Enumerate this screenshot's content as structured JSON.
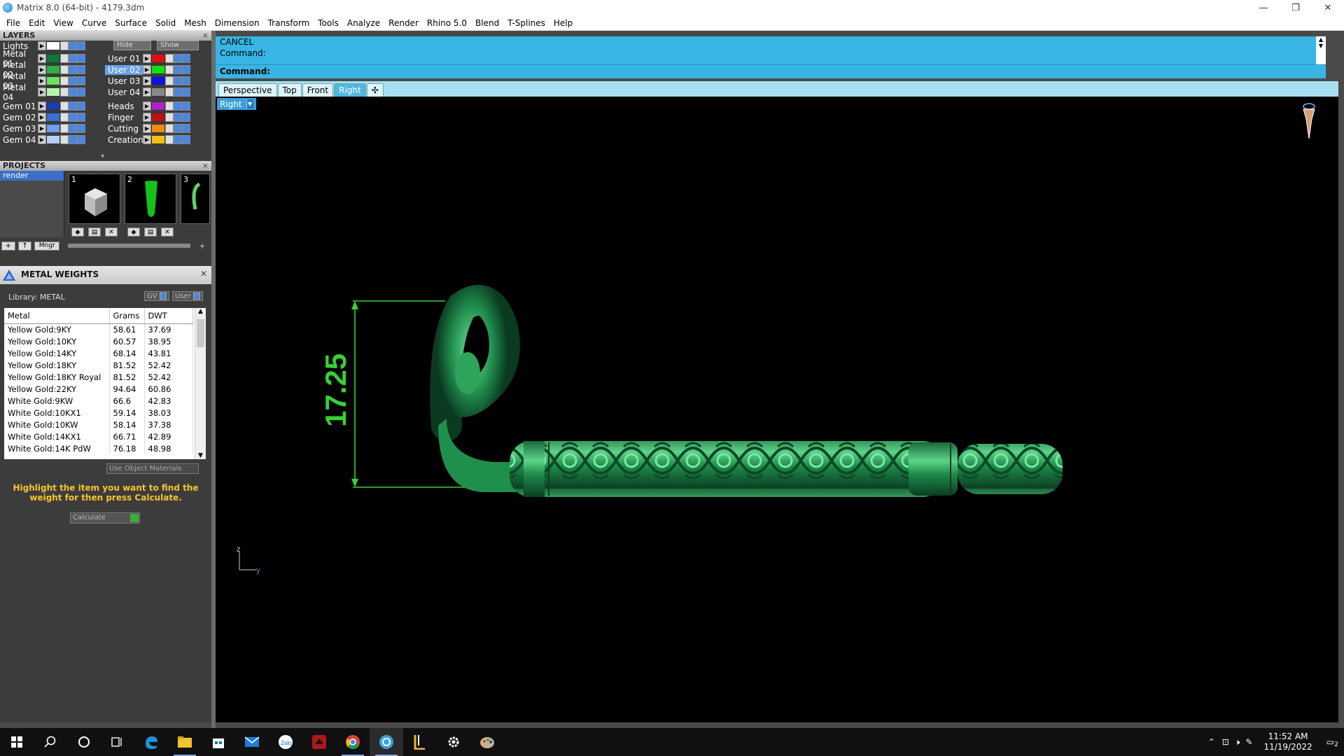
{
  "window": {
    "title": "Matrix 8.0 (64-bit) - 4179.3dm",
    "minimize": "—",
    "restore": "❐",
    "close": "✕"
  },
  "menu": [
    "File",
    "Edit",
    "View",
    "Curve",
    "Surface",
    "Solid",
    "Mesh",
    "Dimension",
    "Transform",
    "Tools",
    "Analyze",
    "Render",
    "Rhino 5.0",
    "Blend",
    "T-Splines",
    "Help"
  ],
  "layers": {
    "header": "LAYERS",
    "hide_label": "Hide",
    "show_label": "Show",
    "left": [
      {
        "name": "Lights",
        "color": "#ffffff"
      },
      {
        "name": "Metal 01",
        "color": "#0e7a3a"
      },
      {
        "name": "Metal 02",
        "color": "#2fb04a"
      },
      {
        "name": "Metal 03",
        "color": "#6de35a"
      },
      {
        "name": "Metal 04",
        "color": "#b9f5a8"
      },
      {
        "name": "Gem 01",
        "color": "#1840a8"
      },
      {
        "name": "Gem 02",
        "color": "#3a6fd6"
      },
      {
        "name": "Gem 03",
        "color": "#6a9ef0"
      },
      {
        "name": "Gem 04",
        "color": "#b3cff8"
      }
    ],
    "right": [
      {
        "name": "User 01",
        "color": "#e01010"
      },
      {
        "name": "User 02",
        "color": "#10e010"
      },
      {
        "name": "User 03",
        "color": "#1010e0"
      },
      {
        "name": "User 04",
        "color": "#888888"
      },
      {
        "name": "Heads",
        "color": "#b020c8"
      },
      {
        "name": "Finger",
        "color": "#c01010"
      },
      {
        "name": "Cutting",
        "color": "#f08a10"
      },
      {
        "name": "Creation",
        "color": "#f2c010"
      }
    ]
  },
  "projects": {
    "header": "PROJECTS",
    "selected": "render",
    "thumbs": [
      "1",
      "2",
      "3"
    ],
    "mngr_label": "Mngr"
  },
  "metal_weights": {
    "header": "METAL WEIGHTS",
    "library": "Library: METAL",
    "toggle_gv": "GV",
    "toggle_user": "User",
    "columns": [
      "Metal",
      "Grams",
      "DWT"
    ],
    "rows": [
      [
        "Yellow Gold:9KY",
        "58.61",
        "37.69"
      ],
      [
        "Yellow Gold:10KY",
        "60.57",
        "38.95"
      ],
      [
        "Yellow Gold:14KY",
        "68.14",
        "43.81"
      ],
      [
        "Yellow Gold:18KY",
        "81.52",
        "52.42"
      ],
      [
        "Yellow Gold:18KY Royal",
        "81.52",
        "52.42"
      ],
      [
        "Yellow Gold:22KY",
        "94.64",
        "60.86"
      ],
      [
        "White Gold:9KW",
        "66.6",
        "42.83"
      ],
      [
        "White Gold:10KX1",
        "59.14",
        "38.03"
      ],
      [
        "White Gold:10KW",
        "58.14",
        "37.38"
      ],
      [
        "White Gold:14KX1",
        "66.71",
        "42.89"
      ],
      [
        "White Gold:14K PdW",
        "76.18",
        "48.98"
      ]
    ],
    "use_object_materials": "Use Object Materials",
    "hint": "Highlight the item you want to find the weight for then press Calculate.",
    "calculate": "Calculate"
  },
  "command": {
    "line1": "CANCEL",
    "line2": "Command:",
    "prompt": "Command:"
  },
  "viewport_tabs": [
    "Perspective",
    "Top",
    "Front",
    "Right"
  ],
  "active_tab": "Right",
  "viewport_label": "Right",
  "dimension_value": "17.25",
  "axis": {
    "z": "z",
    "y": "y"
  },
  "taskbar": {
    "time": "11:52 AM",
    "date": "11/19/2022",
    "notif_count": "2"
  }
}
